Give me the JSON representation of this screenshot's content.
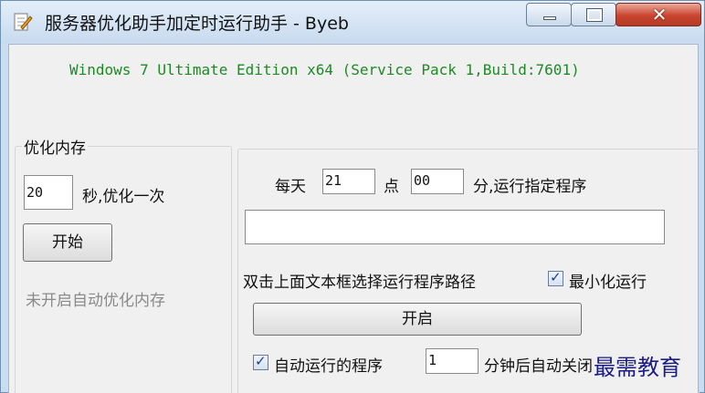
{
  "window": {
    "title": "服务器优化助手加定时运行助手 - Byeb",
    "minimize_icon": "minimize-icon",
    "maximize_icon": "maximize-icon",
    "close_icon": "close-icon",
    "close_glyph": "✕"
  },
  "version_text": "Windows 7 Ultimate Edition x64 (Service Pack 1,Build:7601)",
  "memory_group": {
    "title": "优化内存",
    "interval_value": "20",
    "interval_label": "秒,优化一次",
    "start_button": "开始",
    "status_text": "未开启自动优化内存"
  },
  "schedule_group": {
    "daily_label": "每天",
    "hour_value": "21",
    "hour_label": "点",
    "minute_value": "00",
    "minute_label": "分,运行指定程序",
    "program_path": "",
    "hint_text": "双击上面文本框选择运行程序路径",
    "minimize_checked": true,
    "minimize_label": "最小化运行",
    "enable_button": "开启",
    "auto_close_checked": true,
    "auto_close_label": "自动运行的程序",
    "auto_close_minutes": "1",
    "auto_close_suffix": "分钟后自动关闭"
  },
  "watermark": "最需教育",
  "colors": {
    "version_text": "#1d8a24",
    "close_button": "#c9442e",
    "watermark": "#1c1c86"
  }
}
